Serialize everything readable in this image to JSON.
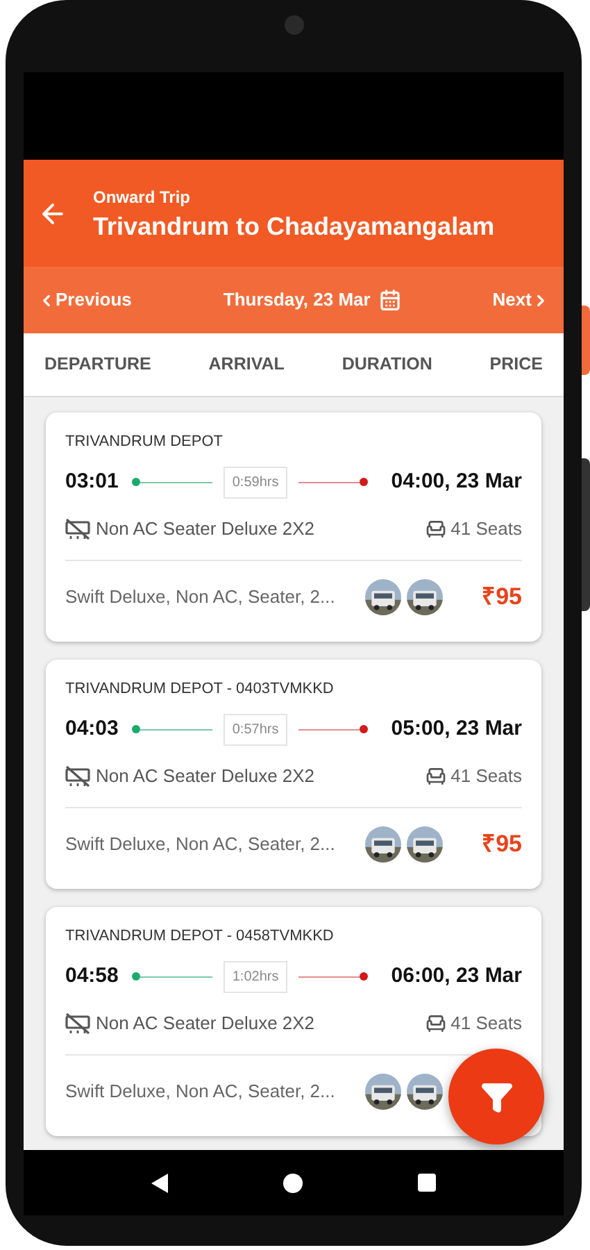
{
  "header": {
    "subtitle": "Onward Trip",
    "title": "Trivandrum to Chadayamangalam"
  },
  "date_bar": {
    "previous": "Previous",
    "date": "Thursday, 23 Mar",
    "next": "Next"
  },
  "sort_tabs": [
    "DEPARTURE",
    "ARRIVAL",
    "DURATION",
    "PRICE"
  ],
  "trips": [
    {
      "depot": "TRIVANDRUM DEPOT",
      "departure": "03:01",
      "duration": "0:59hrs",
      "arrival": "04:00, 23 Mar",
      "bus_type": "Non AC Seater Deluxe 2X2",
      "seats": "41 Seats",
      "description": "Swift Deluxe, Non AC, Seater, 2...",
      "price": "₹95"
    },
    {
      "depot": "TRIVANDRUM DEPOT - 0403TVMKKD",
      "departure": "04:03",
      "duration": "0:57hrs",
      "arrival": "05:00, 23 Mar",
      "bus_type": "Non AC Seater Deluxe 2X2",
      "seats": "41 Seats",
      "description": "Swift Deluxe, Non AC, Seater, 2...",
      "price": "₹95"
    },
    {
      "depot": "TRIVANDRUM DEPOT - 0458TVMKKD",
      "departure": "04:58",
      "duration": "1:02hrs",
      "arrival": "06:00, 23 Mar",
      "bus_type": "Non AC Seater Deluxe 2X2",
      "seats": "41 Seats",
      "description": "Swift Deluxe, Non AC, Seater, 2..."
    }
  ]
}
